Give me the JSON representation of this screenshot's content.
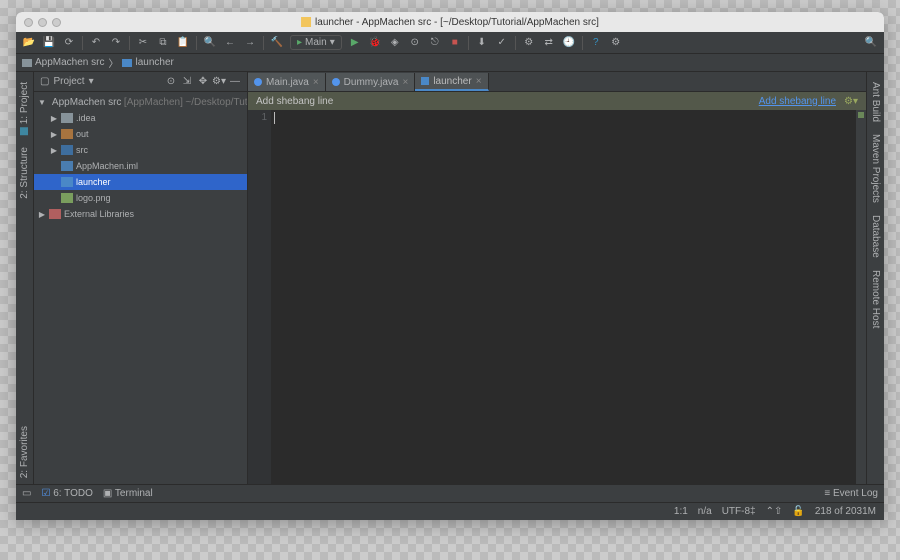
{
  "titlebar": {
    "title": "launcher - AppMachen src - [~/Desktop/Tutorial/AppMachen src]"
  },
  "toolbar": {
    "run_config": "Main"
  },
  "breadcrumb": {
    "items": [
      {
        "icon": "folder",
        "label": "AppMachen src"
      },
      {
        "icon": "sh",
        "label": "launcher"
      }
    ]
  },
  "left_tabs": {
    "project": "1: Project",
    "structure": "2: Structure",
    "favorites": "2: Favorites"
  },
  "right_tabs": {
    "ant": "Ant Build",
    "maven": "Maven Projects",
    "database": "Database",
    "remote": "Remote Host"
  },
  "project_panel": {
    "header": "Project"
  },
  "tree": {
    "root": {
      "label": "AppMachen src",
      "ctx": "[AppMachen]",
      "detail": "~/Desktop/Tutorial/A…"
    },
    "idea": ".idea",
    "out": "out",
    "src": "src",
    "iml": "AppMachen.iml",
    "launcher": "launcher",
    "logo": "logo.png",
    "ext": "External Libraries"
  },
  "tabs": {
    "main": "Main.java",
    "dummy": "Dummy.java",
    "launcher": "launcher"
  },
  "banner": {
    "text": "Add shebang line",
    "action": "Add shebang line"
  },
  "editor": {
    "line1": "1"
  },
  "bottom": {
    "todo": "6: TODO",
    "terminal": "Terminal",
    "eventlog": "Event Log"
  },
  "status": {
    "pos": "1:1",
    "insert": "n/a",
    "encoding": "UTF-8",
    "hint": "⌃⇧",
    "mem": "218 of 2031M"
  }
}
